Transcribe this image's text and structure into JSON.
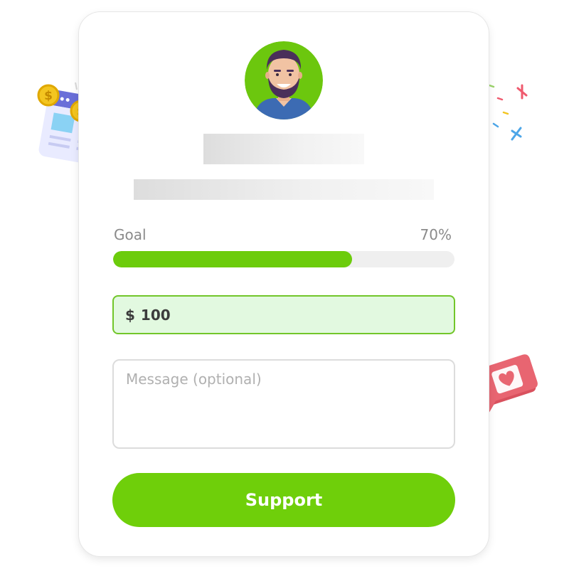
{
  "goal": {
    "label": "Goal",
    "percent_text": "70%",
    "progress_fraction": 0.7,
    "fill_color": "#6ccc0c"
  },
  "amount": {
    "currency": "$",
    "value": "100"
  },
  "message": {
    "placeholder": "Message (optional)"
  },
  "support_button": {
    "label": "Support",
    "color": "#6fcf0a"
  },
  "icons": {
    "avatar": "bearded-man-avatar",
    "coins_window": "browser-window-with-coins-icon",
    "confetti": "confetti-burst-icon",
    "heart_bubble": "heart-speech-bubble-icon"
  }
}
